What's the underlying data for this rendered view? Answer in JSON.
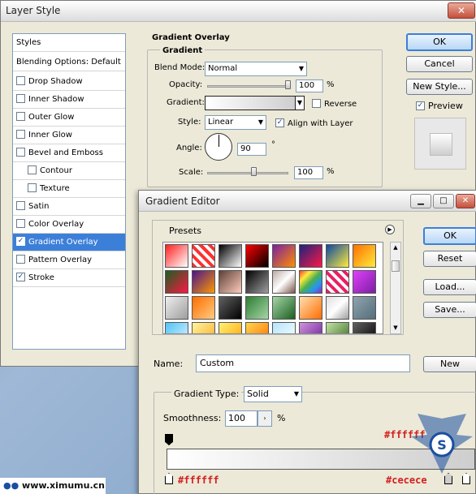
{
  "layer_style": {
    "title": "Layer Style",
    "styles_header": "Styles",
    "blending_options": "Blending Options: Default",
    "styles": [
      {
        "label": "Drop Shadow",
        "checked": false,
        "indent": false,
        "selected": false
      },
      {
        "label": "Inner Shadow",
        "checked": false,
        "indent": false,
        "selected": false
      },
      {
        "label": "Outer Glow",
        "checked": false,
        "indent": false,
        "selected": false
      },
      {
        "label": "Inner Glow",
        "checked": false,
        "indent": false,
        "selected": false
      },
      {
        "label": "Bevel and Emboss",
        "checked": false,
        "indent": false,
        "selected": false
      },
      {
        "label": "Contour",
        "checked": false,
        "indent": true,
        "selected": false
      },
      {
        "label": "Texture",
        "checked": false,
        "indent": true,
        "selected": false
      },
      {
        "label": "Satin",
        "checked": false,
        "indent": false,
        "selected": false
      },
      {
        "label": "Color Overlay",
        "checked": false,
        "indent": false,
        "selected": false
      },
      {
        "label": "Gradient Overlay",
        "checked": true,
        "indent": false,
        "selected": true
      },
      {
        "label": "Pattern Overlay",
        "checked": false,
        "indent": false,
        "selected": false
      },
      {
        "label": "Stroke",
        "checked": true,
        "indent": false,
        "selected": false
      }
    ],
    "section_title": "Gradient Overlay",
    "group_title": "Gradient",
    "blend_mode_label": "Blend Mode:",
    "blend_mode_value": "Normal",
    "opacity_label": "Opacity:",
    "opacity_value": "100",
    "opacity_fraction": 1.0,
    "percent": "%",
    "gradient_label": "Gradient:",
    "reverse_label": "Reverse",
    "style_label": "Style:",
    "style_value": "Linear",
    "align_label": "Align with Layer",
    "align_checked": true,
    "angle_label": "Angle:",
    "angle_value": "90",
    "degree": "°",
    "scale_label": "Scale:",
    "scale_value": "100",
    "scale_fraction": 0.58,
    "ok": "OK",
    "cancel": "Cancel",
    "new_style": "New Style...",
    "preview_label": "Preview",
    "preview_checked": true
  },
  "gradient_editor": {
    "title": "Gradient Editor",
    "presets_label": "Presets",
    "ok": "OK",
    "reset": "Reset",
    "load": "Load...",
    "save": "Save...",
    "name_label": "Name:",
    "name_value": "Custom",
    "new_button": "New",
    "gradient_type_label": "Gradient Type:",
    "gradient_type_value": "Solid",
    "smoothness_label": "Smoothness:",
    "smoothness_value": "100",
    "percent": "%",
    "stop_top_hex": "#ffffff",
    "stop_bottom_left_hex": "#ffffff",
    "stop_bottom_right_hex": "#cecece",
    "colors": {
      "start": "#ffffff",
      "end": "#cecece"
    }
  },
  "watermark": {
    "site": "www.ximumu.cn"
  },
  "presets": [
    "linear-gradient(135deg,#ff2020,#ffffff)",
    "repeating-linear-gradient(45deg,#ff3030 0 4px,#ffffff 4px 8px)",
    "linear-gradient(135deg,#000,#fff)",
    "linear-gradient(135deg,#ff0000,#000)",
    "linear-gradient(135deg,#7b1fa2,#ff8f00)",
    "linear-gradient(135deg,#1a237e,#ff1744)",
    "linear-gradient(135deg,#0d47a1,#ffeb3b)",
    "linear-gradient(135deg,#ff6f00,#ffeb3b)",
    "linear-gradient(135deg,#1b5e20,#ff1744)",
    "linear-gradient(135deg,#4a148c,#ff9800)",
    "linear-gradient(135deg,#5d4037,#ffccbc)",
    "linear-gradient(135deg,#000,#9e9e9e)",
    "linear-gradient(135deg,#bcaaa4,#ffffff,#795548)",
    "linear-gradient(135deg,#f44336,#ffeb3b,#4caf50,#2196f3,#9c27b0)",
    "repeating-linear-gradient(45deg,#e91e63 0 4px,#ffffff 4px 8px)",
    "linear-gradient(135deg,#e040fb,#7b1fa2)",
    "linear-gradient(135deg,#eeeeee,#9e9e9e)",
    "linear-gradient(135deg,#ff6d00,#ffcc80)",
    "linear-gradient(135deg,#616161,#000)",
    "linear-gradient(135deg,#2e7d32,#a5d6a7)",
    "linear-gradient(135deg,#a5d6a7,#1b5e20)",
    "linear-gradient(135deg,#ffe0b2,#ff6d00)",
    "linear-gradient(135deg,#e0e0e0,#ffffff,#9e9e9e)",
    "linear-gradient(135deg,#90a4ae,#546e7a)",
    "linear-gradient(135deg,#4fc3f7,#e1f5fe)",
    "linear-gradient(135deg,#fff59d,#f9a825)",
    "linear-gradient(135deg,#fff176,#ffa000)",
    "linear-gradient(135deg,#ffd54f,#ff6f00)",
    "linear-gradient(135deg,#b3e5fc,#ffffff)",
    "linear-gradient(135deg,#ce93d8,#6a1b9a)",
    "linear-gradient(135deg,#c5e1a5,#33691e)",
    "linear-gradient(135deg,#616161,#000)"
  ]
}
